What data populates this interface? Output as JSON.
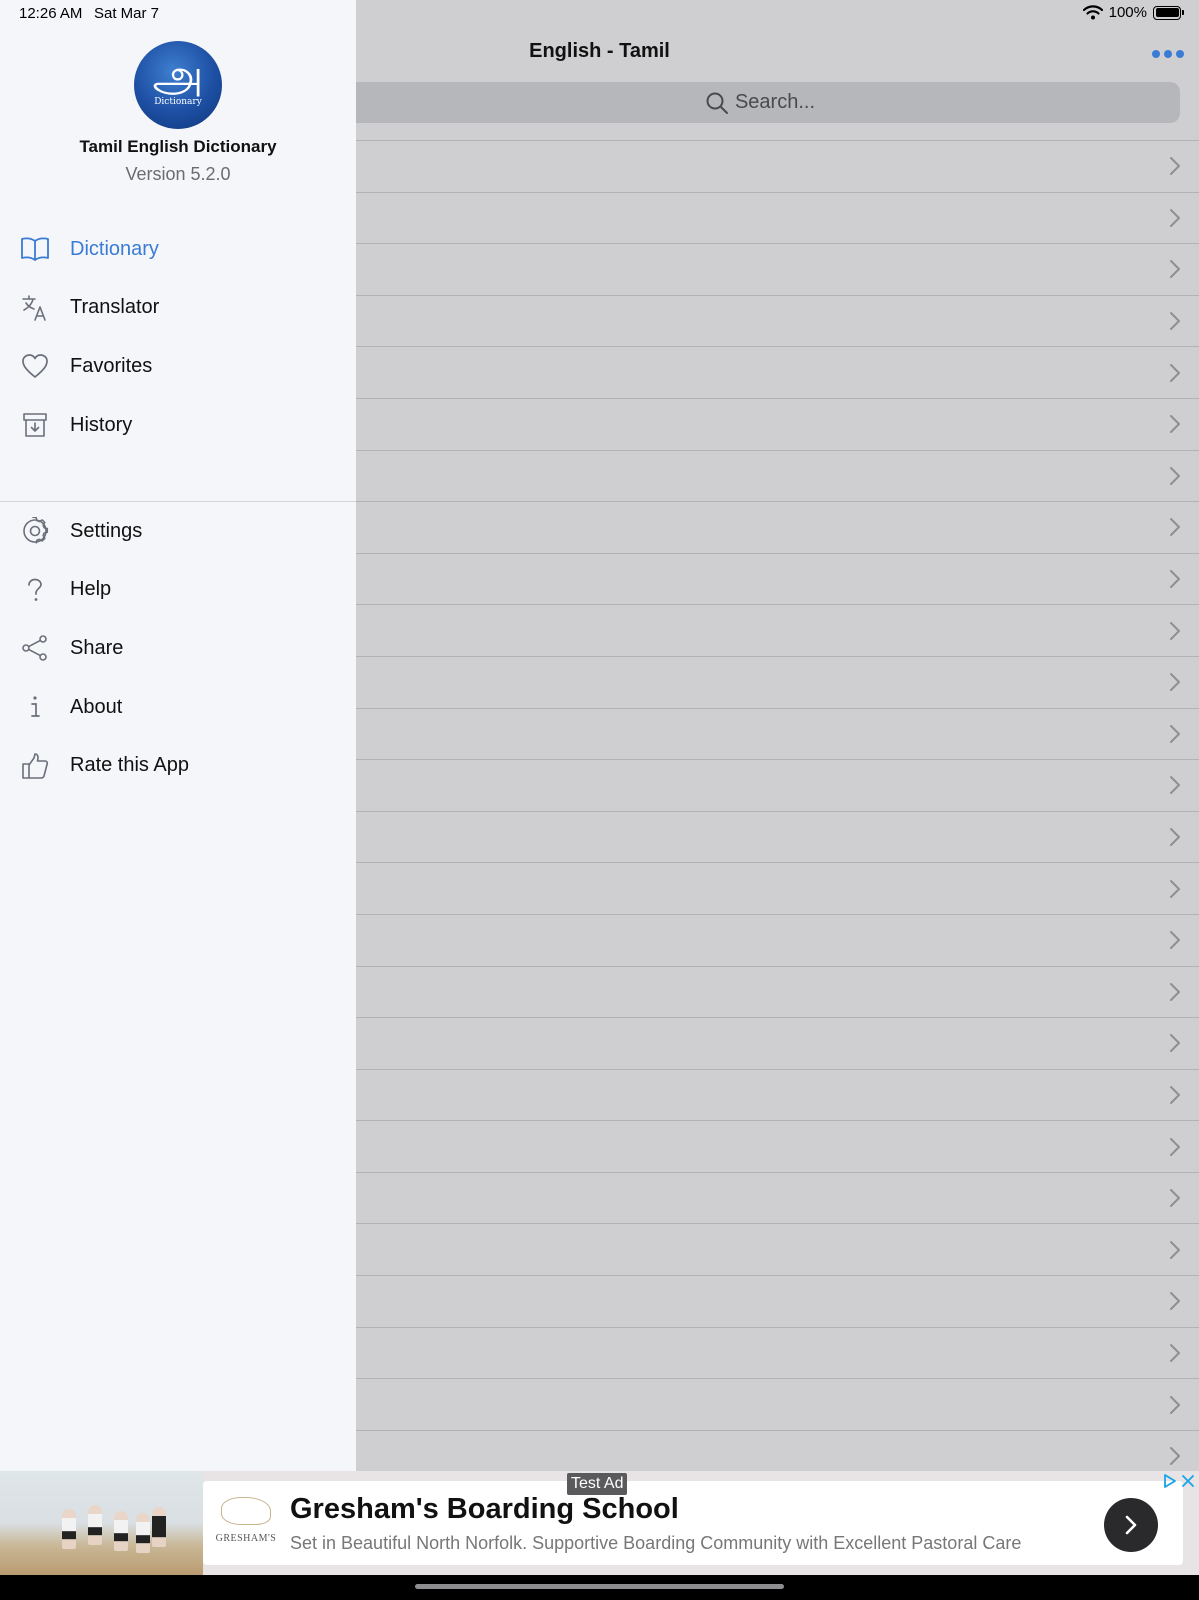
{
  "status_bar": {
    "time": "12:26 AM",
    "date": "Sat Mar 7",
    "battery": "100%",
    "battery_level": 1.0
  },
  "header": {
    "title": "English - Tamil"
  },
  "search": {
    "placeholder": "Search..."
  },
  "list": {
    "row_count": 26
  },
  "drawer": {
    "logo_glyph": "அ",
    "logo_caption": "Dictionary",
    "app_name": "Tamil English Dictionary",
    "version": "Version 5.2.0",
    "primary_items": [
      {
        "label": "Dictionary",
        "icon": "book-icon",
        "active": true
      },
      {
        "label": "Translator",
        "icon": "translate-icon",
        "active": false
      },
      {
        "label": "Favorites",
        "icon": "heart-icon",
        "active": false
      },
      {
        "label": "History",
        "icon": "archive-icon",
        "active": false
      }
    ],
    "secondary_items": [
      {
        "label": "Settings",
        "icon": "gear-icon"
      },
      {
        "label": "Help",
        "icon": "question-icon"
      },
      {
        "label": "Share",
        "icon": "share-icon"
      },
      {
        "label": "About",
        "icon": "info-icon"
      },
      {
        "label": "Rate this App",
        "icon": "thumbs-up-icon"
      }
    ]
  },
  "ad": {
    "label": "Test Ad",
    "title": "Gresham's Boarding School",
    "subtitle": "Set in Beautiful North Norfolk. Supportive Boarding Community with Excellent Pastoral Care",
    "logo_text": "GRESHAM'S"
  },
  "colors": {
    "accent": "#3a7bd5",
    "drawer_bg": "#f5f6fa",
    "dim_bg": "#cfcfd1"
  }
}
